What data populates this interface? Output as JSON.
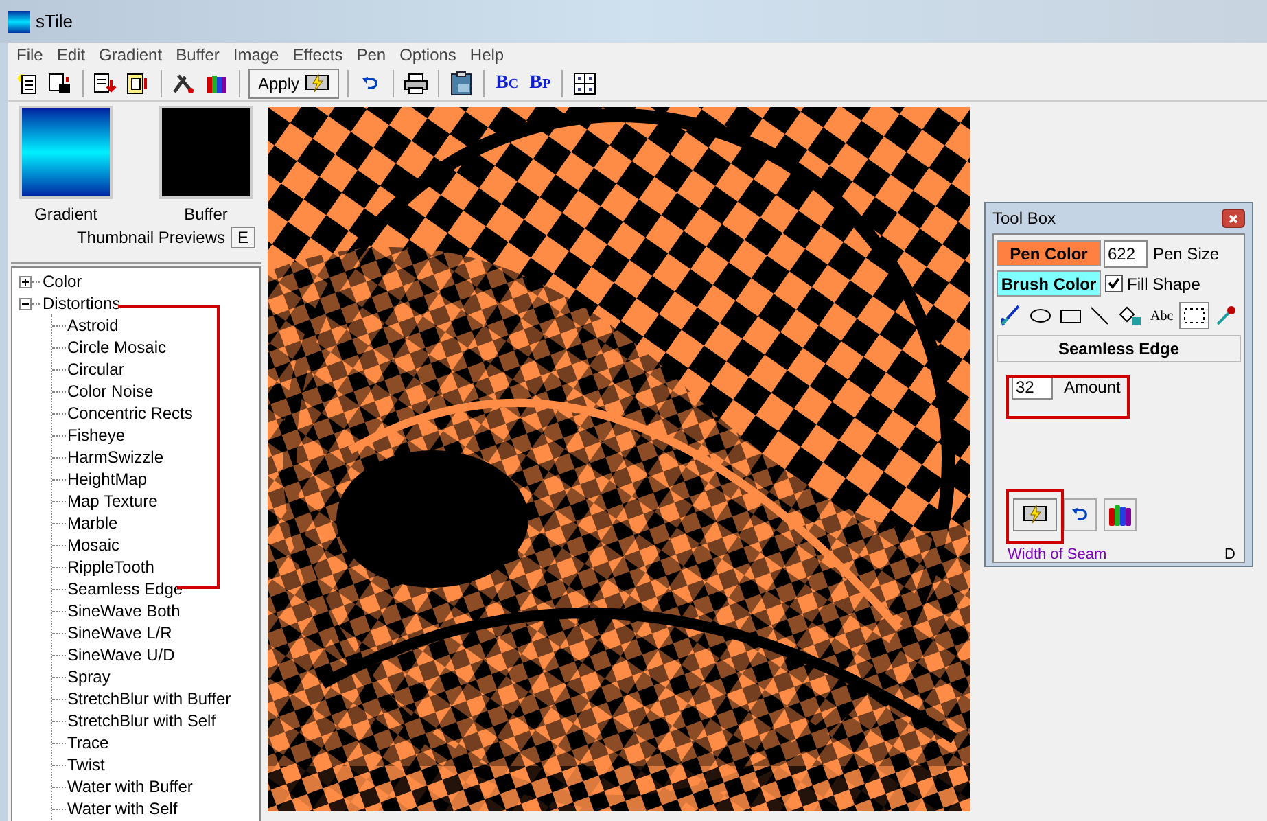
{
  "window": {
    "title": "sTile"
  },
  "menu": [
    "File",
    "Edit",
    "Gradient",
    "Buffer",
    "Image",
    "Effects",
    "Pen",
    "Options",
    "Help"
  ],
  "toolbar": [
    {
      "kind": "new"
    },
    {
      "kind": "save"
    },
    {
      "kind": "sep"
    },
    {
      "kind": "copy"
    },
    {
      "kind": "paste"
    },
    {
      "kind": "sep"
    },
    {
      "kind": "tools"
    },
    {
      "kind": "crayons"
    },
    {
      "kind": "sep"
    },
    {
      "kind": "apply",
      "label": "Apply"
    },
    {
      "kind": "sep"
    },
    {
      "kind": "undo"
    },
    {
      "kind": "sep"
    },
    {
      "kind": "print"
    },
    {
      "kind": "sep"
    },
    {
      "kind": "clipboard"
    },
    {
      "kind": "sep"
    },
    {
      "kind": "letters",
      "label": "B",
      "sub": "C"
    },
    {
      "kind": "letters",
      "label": "B",
      "sub": "P"
    },
    {
      "kind": "sep"
    },
    {
      "kind": "grid"
    }
  ],
  "thumbnails": [
    {
      "label": "Gradient",
      "kind": "gradient"
    },
    {
      "label": "Buffer",
      "kind": "buffer"
    }
  ],
  "thumbnail_caption": "Thumbnail Previews",
  "expand_button": "E",
  "tree": [
    {
      "label": "Color",
      "expanded": false
    },
    {
      "label": "Distortions",
      "expanded": true,
      "children": [
        {
          "label": "Astroid"
        },
        {
          "label": "Circle Mosaic"
        },
        {
          "label": "Circular"
        },
        {
          "label": "Color Noise"
        },
        {
          "label": "Concentric Rects"
        },
        {
          "label": "Fisheye"
        },
        {
          "label": "HarmSwizzle"
        },
        {
          "label": "HeightMap"
        },
        {
          "label": "Map Texture"
        },
        {
          "label": "Marble"
        },
        {
          "label": "Mosaic"
        },
        {
          "label": "RippleTooth"
        },
        {
          "label": "Seamless Edge"
        },
        {
          "label": "SineWave Both"
        },
        {
          "label": "SineWave L/R"
        },
        {
          "label": "SineWave U/D"
        },
        {
          "label": "Spray"
        },
        {
          "label": "StretchBlur with Buffer"
        },
        {
          "label": "StretchBlur with Self"
        },
        {
          "label": "Trace"
        },
        {
          "label": "Twist"
        },
        {
          "label": "Water with Buffer"
        },
        {
          "label": "Water with Self"
        }
      ]
    }
  ],
  "toolbox": {
    "title": "Tool Box",
    "pen_color_button": "Pen Color",
    "pen_size": "622",
    "pen_size_label": "Pen Size",
    "brush_color_button": "Brush Color",
    "fill_shape": {
      "label": "Fill Shape",
      "checked": true
    },
    "tools": [
      {
        "kind": "brush",
        "selected": false
      },
      {
        "kind": "ellipse",
        "selected": false
      },
      {
        "kind": "rect",
        "selected": false
      },
      {
        "kind": "line",
        "selected": false
      },
      {
        "kind": "fill",
        "selected": false
      },
      {
        "kind": "text",
        "label": "Abc",
        "selected": false
      },
      {
        "kind": "select",
        "selected": true
      },
      {
        "kind": "dropper",
        "selected": false
      }
    ],
    "effect_title": "Seamless Edge",
    "amount": "32",
    "amount_label": "Amount",
    "hint": "Width of Seam",
    "corner_label": "D"
  }
}
